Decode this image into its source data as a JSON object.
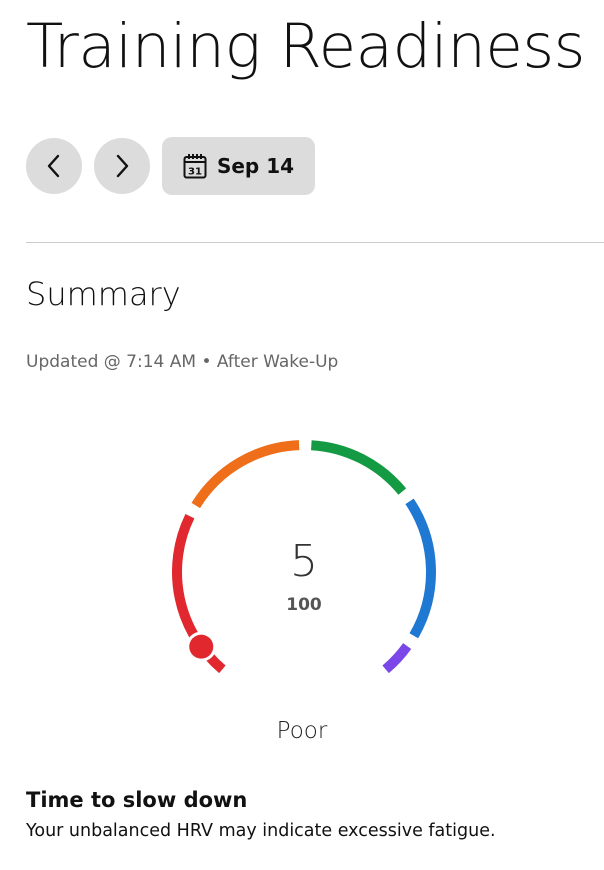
{
  "page": {
    "title": "Training Readiness"
  },
  "date_nav": {
    "prev_icon": "chevron-left-icon",
    "next_icon": "chevron-right-icon",
    "calendar_icon": "calendar-icon",
    "calendar_day": "31",
    "date": "Sep 14"
  },
  "summary": {
    "title": "Summary",
    "updated": "Updated @ 7:14 AM • After Wake-Up"
  },
  "gauge": {
    "score": "5",
    "max": "100",
    "score_fraction": 0.05,
    "status": "Poor",
    "segment_colors": {
      "poor": "#e0282e",
      "low": "#ee6e1a",
      "moderate": "#139a43",
      "high": "#1f78d1",
      "prime": "#7b47e8"
    }
  },
  "advice": {
    "title": "Time to slow down",
    "text": "Your unbalanced HRV may indicate excessive fatigue."
  }
}
